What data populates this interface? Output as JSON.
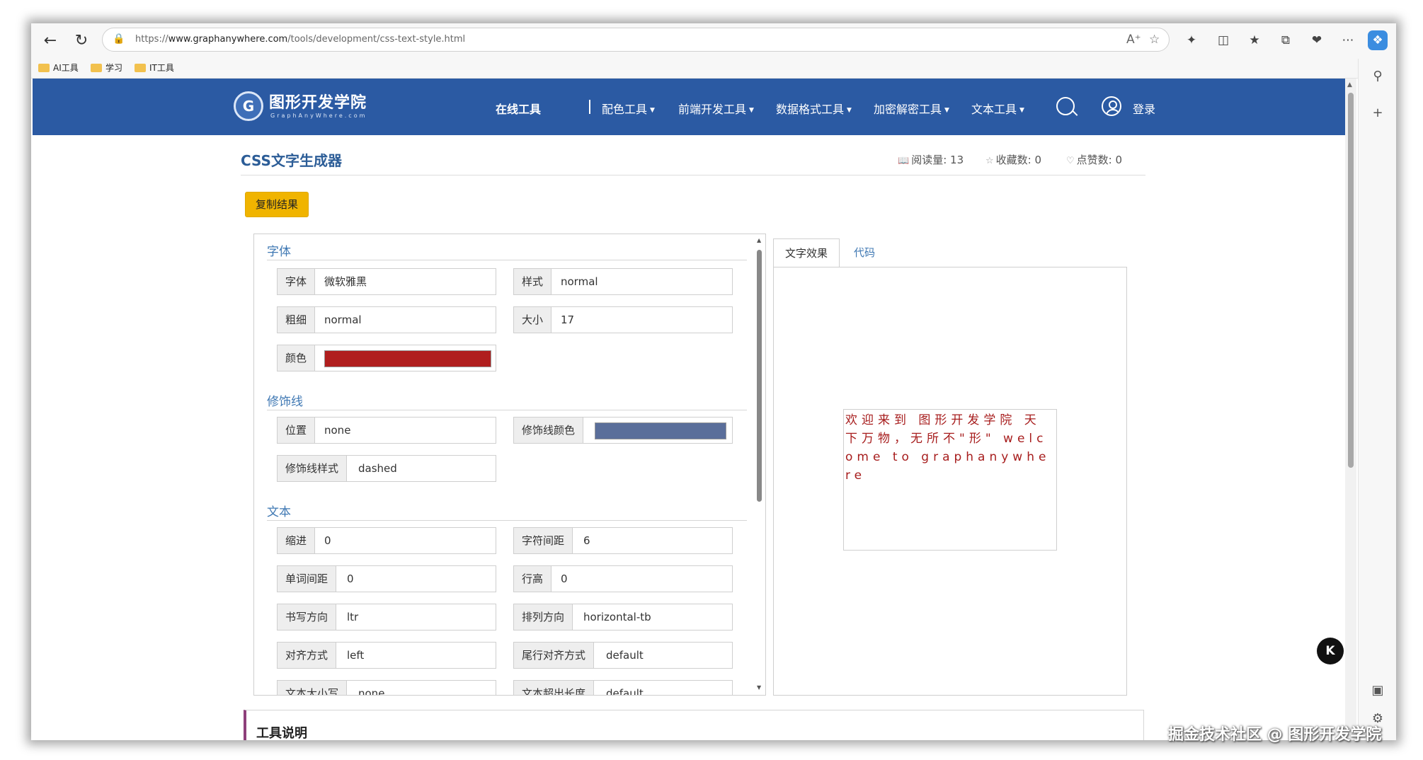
{
  "browser": {
    "url_prefix": "https://",
    "url_host": "www.graphanywhere.com",
    "url_path": "/tools/development/css-text-style.html",
    "bookmarks": [
      "AI工具",
      "学习",
      "IT工具"
    ]
  },
  "site": {
    "logo_name": "图形开发学院",
    "logo_sub": "GraphAnyWhere.com",
    "nav": {
      "online_tools": "在线工具",
      "color_tools": "配色工具",
      "frontend_tools": "前端开发工具",
      "data_format_tools": "数据格式工具",
      "crypto_tools": "加密解密工具",
      "text_tools": "文本工具",
      "login": "登录"
    }
  },
  "page": {
    "title": "CSS文字生成器",
    "reads_label": "阅读量:",
    "reads_value": "13",
    "favorites_label": "收藏数:",
    "favorites_value": "0",
    "likes_label": "点赞数:",
    "likes_value": "0",
    "copy_button": "复制结果"
  },
  "settings": {
    "font_section": "字体",
    "decoration_section": "修饰线",
    "text_section": "文本",
    "font_family_label": "字体",
    "font_family_value": "微软雅黑",
    "font_style_label": "样式",
    "font_style_value": "normal",
    "font_weight_label": "粗细",
    "font_weight_value": "normal",
    "font_size_label": "大小",
    "font_size_value": "17",
    "color_label": "颜色",
    "color_value": "#b01e1e",
    "decoration_line_label": "位置",
    "decoration_line_value": "none",
    "decoration_color_label": "修饰线颜色",
    "decoration_color_value": "#5a6e9a",
    "decoration_style_label": "修饰线样式",
    "decoration_style_value": "dashed",
    "indent_label": "缩进",
    "indent_value": "0",
    "letter_spacing_label": "字符间距",
    "letter_spacing_value": "6",
    "word_spacing_label": "单词间距",
    "word_spacing_value": "0",
    "line_height_label": "行高",
    "line_height_value": "0",
    "direction_label": "书写方向",
    "direction_value": "ltr",
    "writing_mode_label": "排列方向",
    "writing_mode_value": "horizontal-tb",
    "align_label": "对齐方式",
    "align_value": "left",
    "align_last_label": "尾行对齐方式",
    "align_last_value": "default",
    "transform_label": "文本大小写",
    "transform_value": "none",
    "overflow_label": "文本超出长度",
    "overflow_value": "default"
  },
  "preview": {
    "tab_effect": "文字效果",
    "tab_code": "代码",
    "sample_text": "欢迎来到 图形开发学院 天下万物，无所不\"形\" welcome to graphanywhere"
  },
  "info": {
    "title": "工具说明"
  },
  "float_button": "K",
  "watermark": "掘金技术社区 @ 图形开发学院"
}
